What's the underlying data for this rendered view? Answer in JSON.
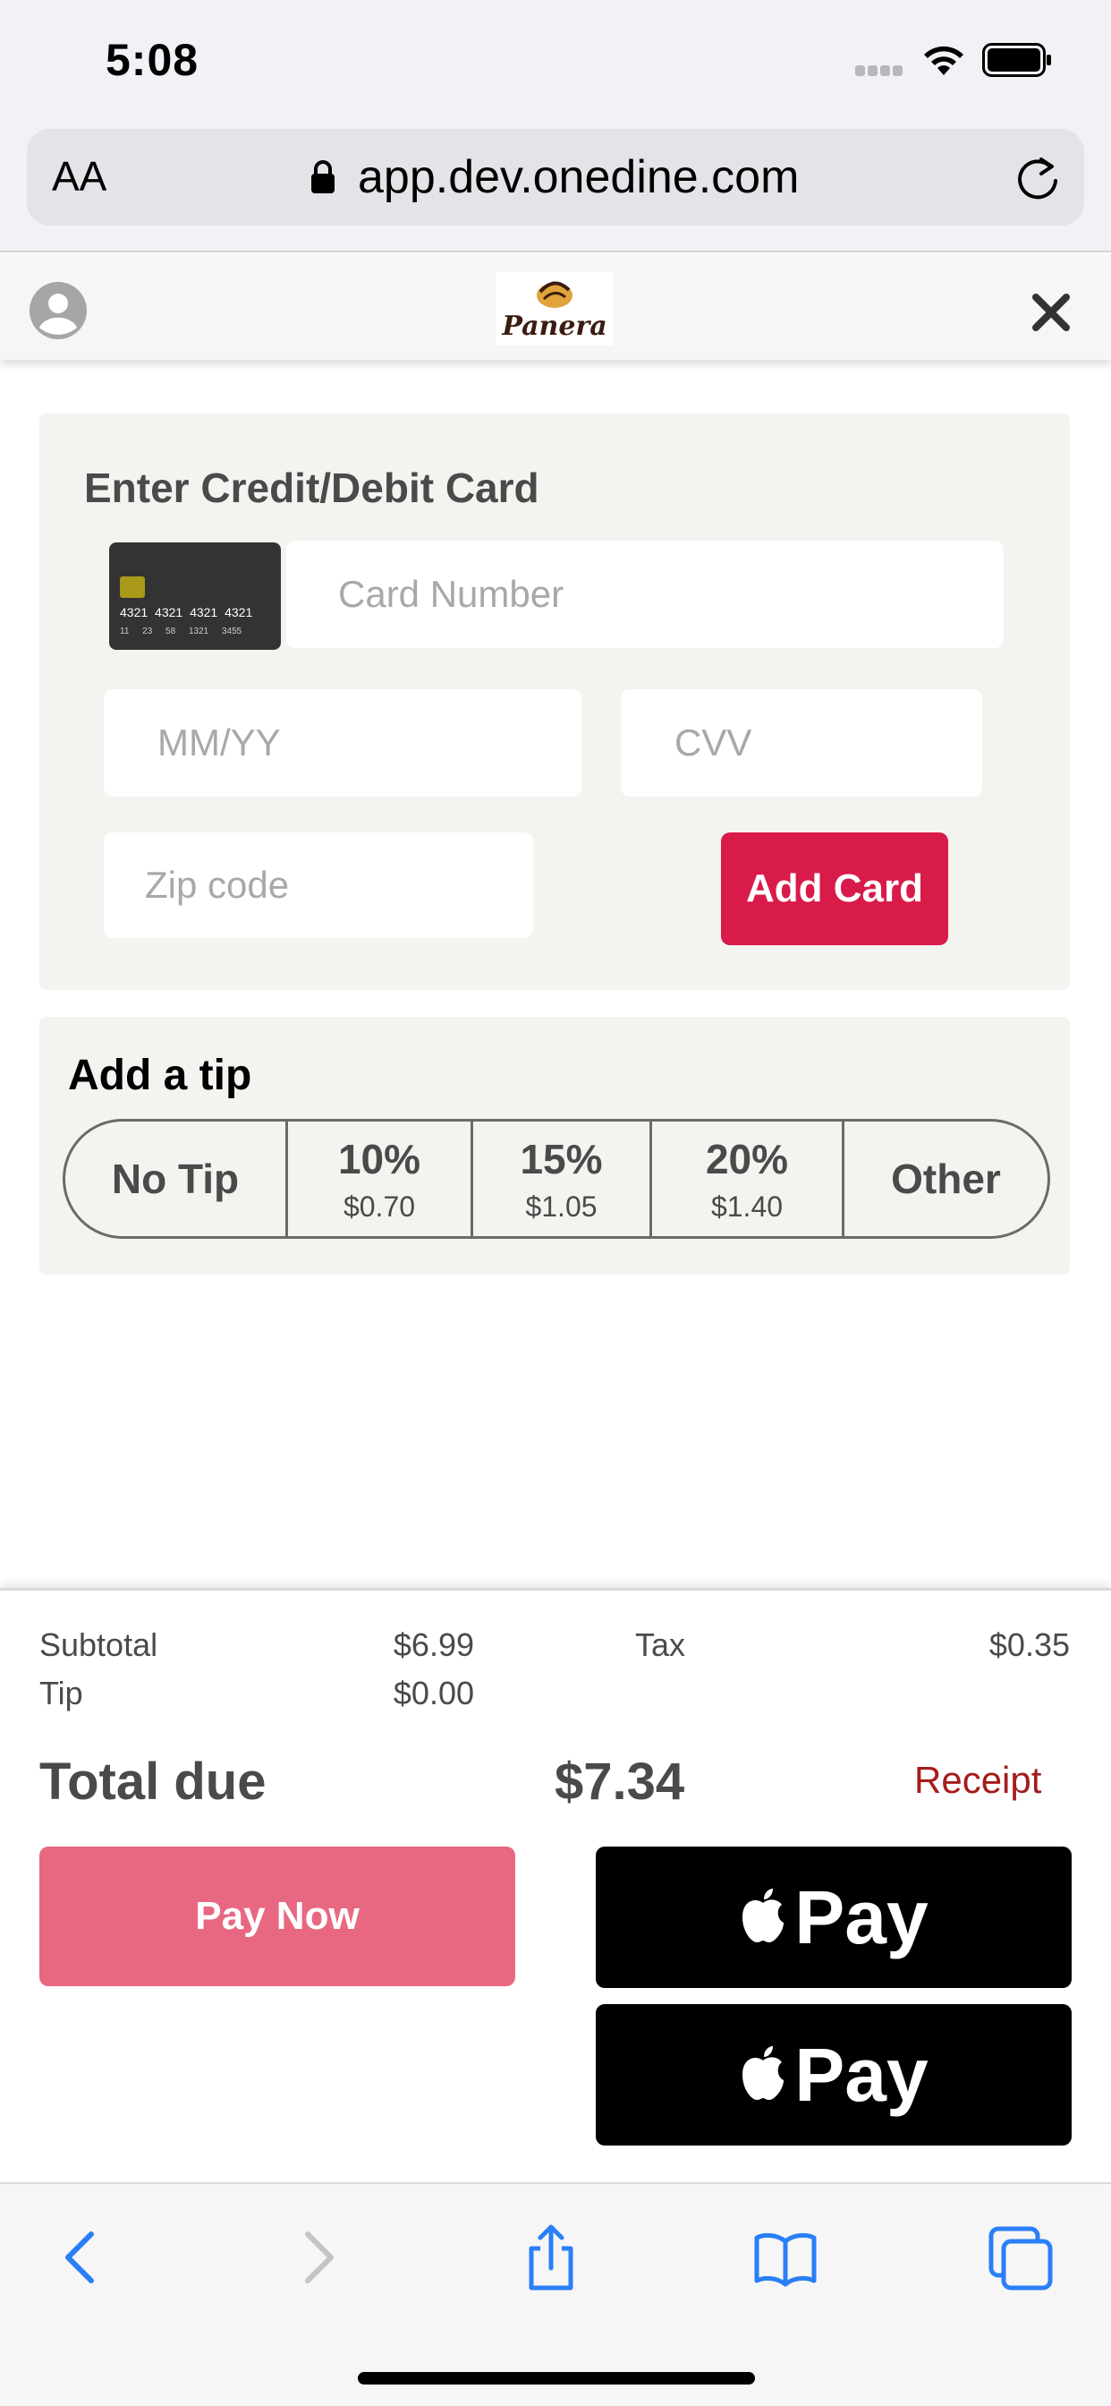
{
  "status_bar": {
    "time": "5:08"
  },
  "browser": {
    "text_size_label": "AA",
    "url": "app.dev.onedine.com"
  },
  "header": {
    "logo_text": "Panera"
  },
  "card_form": {
    "title": "Enter Credit/Debit Card",
    "card_image_digits": "4321 4321 4321 4321",
    "card_image_sub": "11 23 58 1321 3455",
    "card_number_placeholder": "Card Number",
    "expiry_placeholder": "MM/YY",
    "cvv_placeholder": "CVV",
    "zip_placeholder": "Zip code",
    "add_card_label": "Add Card"
  },
  "tip": {
    "title": "Add a tip",
    "options": [
      {
        "label": "No Tip",
        "amount": ""
      },
      {
        "label": "10%",
        "amount": "$0.70"
      },
      {
        "label": "15%",
        "amount": "$1.05"
      },
      {
        "label": "20%",
        "amount": "$1.40"
      },
      {
        "label": "Other",
        "amount": ""
      }
    ]
  },
  "summary": {
    "subtotal_label": "Subtotal",
    "subtotal_value": "$6.99",
    "tax_label": "Tax",
    "tax_value": "$0.35",
    "tip_label": "Tip",
    "tip_value": "$0.00",
    "total_label": "Total due",
    "total_value": "$7.34",
    "receipt_label": "Receipt",
    "pay_now_label": "Pay Now",
    "apple_pay_label": "Pay"
  },
  "colors": {
    "add_card": "#d81b49",
    "pay_now": "#e86882",
    "receipt": "#a41c1c",
    "toolbar_icon": "#2a7ff6",
    "toolbar_icon_disabled": "#c4c4c8"
  },
  "icons": [
    "wifi-icon",
    "battery-icon",
    "lock-icon",
    "reload-icon",
    "avatar-icon",
    "close-icon",
    "apple-logo-icon",
    "back-icon",
    "forward-icon",
    "share-icon",
    "bookmarks-icon",
    "tabs-icon"
  ]
}
